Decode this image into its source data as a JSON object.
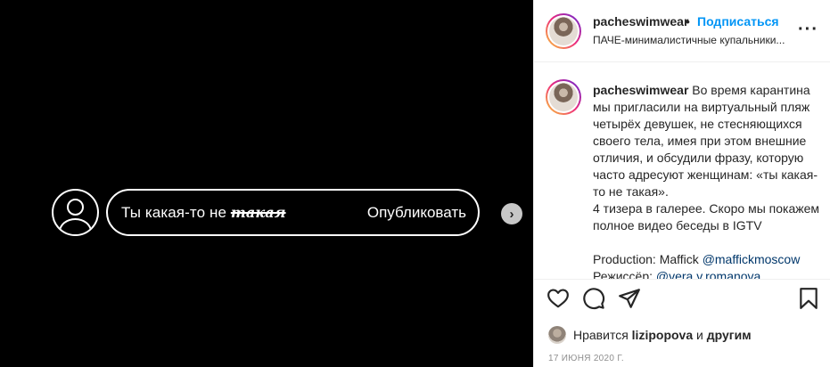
{
  "media": {
    "comment_prefix": "Ты какая-то не",
    "comment_scribble": "такая",
    "publish_label": "Опубликовать",
    "next_icon": "chevron-right-icon"
  },
  "header": {
    "username": "pacheswimwear",
    "separator": "•",
    "follow_label": "Подписаться",
    "subtitle": "ПАЧЕ-минималистичные купальники...",
    "more_icon": "more-icon"
  },
  "caption": {
    "username": "pacheswimwear",
    "lines": [
      "Во время карантина",
      "мы пригласили на виртуальный пляж",
      "четырёх девушек, не стесняющихся",
      "своего тела, имея при этом внешние",
      "отличия, и обсудили фразу, которую",
      "часто адресуют женщинам: «ты какая-",
      "то не такая».",
      "4 тизера в галерее. Скоро мы покажем",
      "полное видео беседы в IGTV"
    ],
    "production_label": "Production: Maffick",
    "production_mention": "@maffickmoscow",
    "director_label": "Режиссёр:",
    "director_mention": "@vera.v.romanova"
  },
  "actions": {
    "like_icon": "heart-icon",
    "comment_icon": "comment-icon",
    "share_icon": "share-icon",
    "save_icon": "bookmark-icon"
  },
  "likes": {
    "prefix": "Нравится",
    "user": "lizipopova",
    "middle": "и",
    "others": "другим"
  },
  "date": "17 июня 2020 г.",
  "colors": {
    "accent": "#0095f6",
    "mention": "#00376b",
    "media_bg": "#000000"
  }
}
